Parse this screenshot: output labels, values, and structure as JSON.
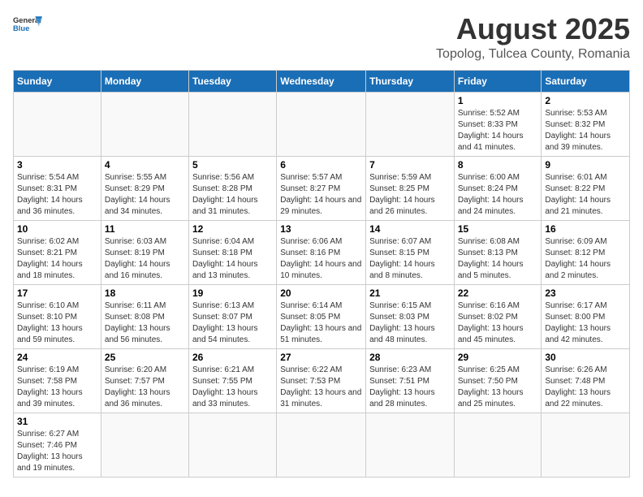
{
  "header": {
    "logo_general": "General",
    "logo_blue": "Blue",
    "main_title": "August 2025",
    "sub_title": "Topolog, Tulcea County, Romania"
  },
  "calendar": {
    "days_of_week": [
      "Sunday",
      "Monday",
      "Tuesday",
      "Wednesday",
      "Thursday",
      "Friday",
      "Saturday"
    ],
    "weeks": [
      [
        {
          "day": "",
          "info": ""
        },
        {
          "day": "",
          "info": ""
        },
        {
          "day": "",
          "info": ""
        },
        {
          "day": "",
          "info": ""
        },
        {
          "day": "",
          "info": ""
        },
        {
          "day": "1",
          "info": "Sunrise: 5:52 AM\nSunset: 8:33 PM\nDaylight: 14 hours and 41 minutes."
        },
        {
          "day": "2",
          "info": "Sunrise: 5:53 AM\nSunset: 8:32 PM\nDaylight: 14 hours and 39 minutes."
        }
      ],
      [
        {
          "day": "3",
          "info": "Sunrise: 5:54 AM\nSunset: 8:31 PM\nDaylight: 14 hours and 36 minutes."
        },
        {
          "day": "4",
          "info": "Sunrise: 5:55 AM\nSunset: 8:29 PM\nDaylight: 14 hours and 34 minutes."
        },
        {
          "day": "5",
          "info": "Sunrise: 5:56 AM\nSunset: 8:28 PM\nDaylight: 14 hours and 31 minutes."
        },
        {
          "day": "6",
          "info": "Sunrise: 5:57 AM\nSunset: 8:27 PM\nDaylight: 14 hours and 29 minutes."
        },
        {
          "day": "7",
          "info": "Sunrise: 5:59 AM\nSunset: 8:25 PM\nDaylight: 14 hours and 26 minutes."
        },
        {
          "day": "8",
          "info": "Sunrise: 6:00 AM\nSunset: 8:24 PM\nDaylight: 14 hours and 24 minutes."
        },
        {
          "day": "9",
          "info": "Sunrise: 6:01 AM\nSunset: 8:22 PM\nDaylight: 14 hours and 21 minutes."
        }
      ],
      [
        {
          "day": "10",
          "info": "Sunrise: 6:02 AM\nSunset: 8:21 PM\nDaylight: 14 hours and 18 minutes."
        },
        {
          "day": "11",
          "info": "Sunrise: 6:03 AM\nSunset: 8:19 PM\nDaylight: 14 hours and 16 minutes."
        },
        {
          "day": "12",
          "info": "Sunrise: 6:04 AM\nSunset: 8:18 PM\nDaylight: 14 hours and 13 minutes."
        },
        {
          "day": "13",
          "info": "Sunrise: 6:06 AM\nSunset: 8:16 PM\nDaylight: 14 hours and 10 minutes."
        },
        {
          "day": "14",
          "info": "Sunrise: 6:07 AM\nSunset: 8:15 PM\nDaylight: 14 hours and 8 minutes."
        },
        {
          "day": "15",
          "info": "Sunrise: 6:08 AM\nSunset: 8:13 PM\nDaylight: 14 hours and 5 minutes."
        },
        {
          "day": "16",
          "info": "Sunrise: 6:09 AM\nSunset: 8:12 PM\nDaylight: 14 hours and 2 minutes."
        }
      ],
      [
        {
          "day": "17",
          "info": "Sunrise: 6:10 AM\nSunset: 8:10 PM\nDaylight: 13 hours and 59 minutes."
        },
        {
          "day": "18",
          "info": "Sunrise: 6:11 AM\nSunset: 8:08 PM\nDaylight: 13 hours and 56 minutes."
        },
        {
          "day": "19",
          "info": "Sunrise: 6:13 AM\nSunset: 8:07 PM\nDaylight: 13 hours and 54 minutes."
        },
        {
          "day": "20",
          "info": "Sunrise: 6:14 AM\nSunset: 8:05 PM\nDaylight: 13 hours and 51 minutes."
        },
        {
          "day": "21",
          "info": "Sunrise: 6:15 AM\nSunset: 8:03 PM\nDaylight: 13 hours and 48 minutes."
        },
        {
          "day": "22",
          "info": "Sunrise: 6:16 AM\nSunset: 8:02 PM\nDaylight: 13 hours and 45 minutes."
        },
        {
          "day": "23",
          "info": "Sunrise: 6:17 AM\nSunset: 8:00 PM\nDaylight: 13 hours and 42 minutes."
        }
      ],
      [
        {
          "day": "24",
          "info": "Sunrise: 6:19 AM\nSunset: 7:58 PM\nDaylight: 13 hours and 39 minutes."
        },
        {
          "day": "25",
          "info": "Sunrise: 6:20 AM\nSunset: 7:57 PM\nDaylight: 13 hours and 36 minutes."
        },
        {
          "day": "26",
          "info": "Sunrise: 6:21 AM\nSunset: 7:55 PM\nDaylight: 13 hours and 33 minutes."
        },
        {
          "day": "27",
          "info": "Sunrise: 6:22 AM\nSunset: 7:53 PM\nDaylight: 13 hours and 31 minutes."
        },
        {
          "day": "28",
          "info": "Sunrise: 6:23 AM\nSunset: 7:51 PM\nDaylight: 13 hours and 28 minutes."
        },
        {
          "day": "29",
          "info": "Sunrise: 6:25 AM\nSunset: 7:50 PM\nDaylight: 13 hours and 25 minutes."
        },
        {
          "day": "30",
          "info": "Sunrise: 6:26 AM\nSunset: 7:48 PM\nDaylight: 13 hours and 22 minutes."
        }
      ],
      [
        {
          "day": "31",
          "info": "Sunrise: 6:27 AM\nSunset: 7:46 PM\nDaylight: 13 hours and 19 minutes."
        },
        {
          "day": "",
          "info": ""
        },
        {
          "day": "",
          "info": ""
        },
        {
          "day": "",
          "info": ""
        },
        {
          "day": "",
          "info": ""
        },
        {
          "day": "",
          "info": ""
        },
        {
          "day": "",
          "info": ""
        }
      ]
    ]
  }
}
